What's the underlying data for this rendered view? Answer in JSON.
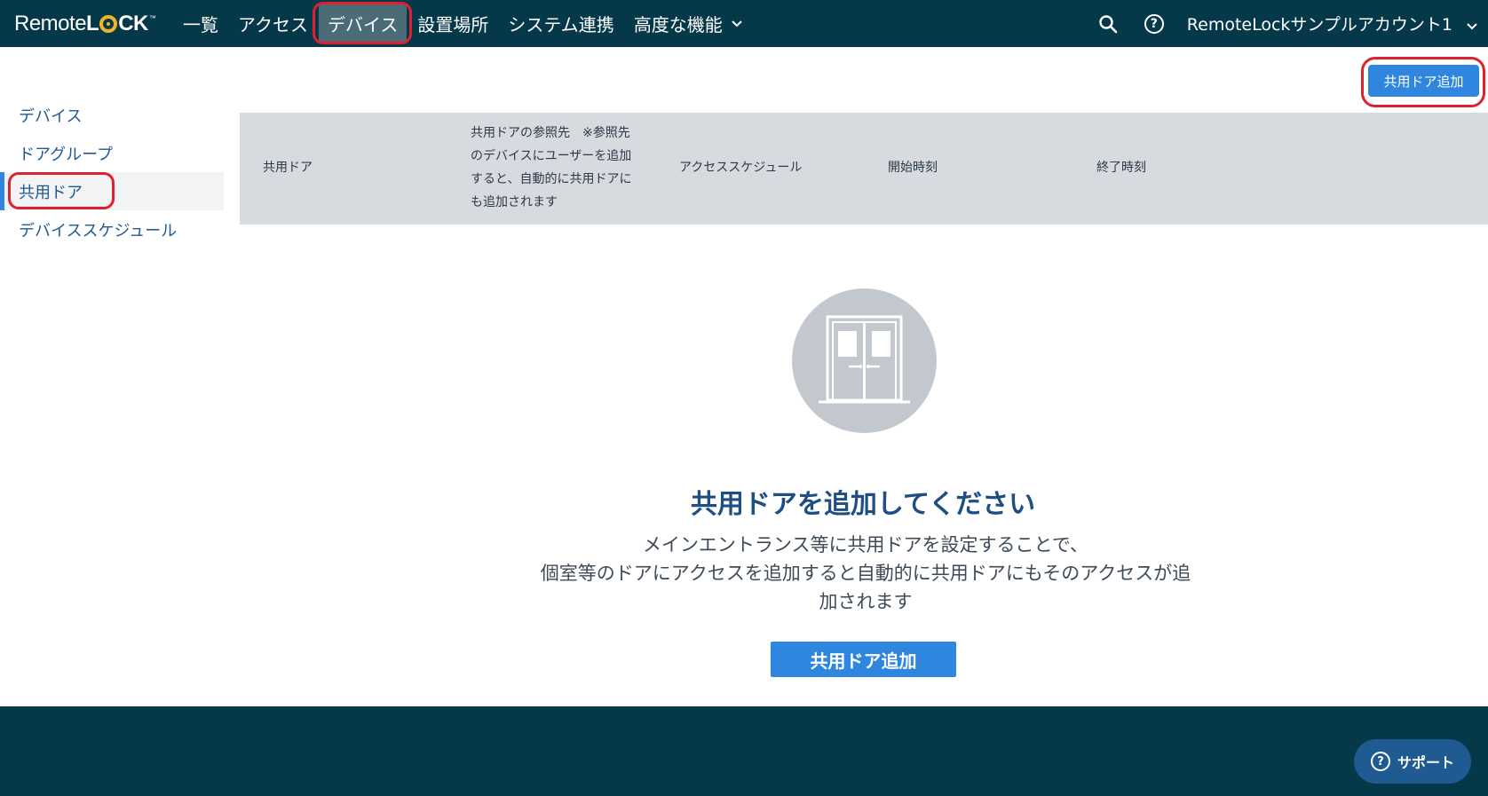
{
  "header": {
    "logo": {
      "prefix": "Remote",
      "brand_l": "L",
      "brand_rest": "CK",
      "tm": "™"
    },
    "nav": [
      {
        "label": "一覧"
      },
      {
        "label": "アクセス"
      },
      {
        "label": "デバイス",
        "active": true
      },
      {
        "label": "設置場所"
      },
      {
        "label": "システム連携"
      },
      {
        "label": "高度な機能",
        "has_dropdown": true
      }
    ],
    "search_icon": "search-icon",
    "help_icon": "help-icon",
    "help_glyph": "?",
    "account_name": "RemoteLockサンプルアカウント1"
  },
  "toolbar": {
    "add_shared_door_label": "共用ドア追加"
  },
  "sidebar": {
    "items": [
      {
        "label": "デバイス"
      },
      {
        "label": "ドアグループ"
      },
      {
        "label": "共用ドア",
        "active": true
      },
      {
        "label": "デバイススケジュール"
      }
    ]
  },
  "table": {
    "columns": [
      "共用ドア",
      "共用ドアの参照先　※参照先のデバイスにユーザーを追加すると、自動的に共用ドアにも追加されます",
      "アクセススケジュール",
      "開始時刻",
      "終了時刻"
    ]
  },
  "empty_state": {
    "icon": "double-door-icon",
    "title": "共用ドアを追加してください",
    "description_lines": [
      "メインエントランス等に共用ドアを設定することで、",
      "個室等のドアにアクセスを追加すると自動的に共用ドアにもそのアクセスが追",
      "加されます"
    ],
    "button_label": "共用ドア追加"
  },
  "support": {
    "label": "サポート",
    "glyph": "?"
  },
  "colors": {
    "header_bg": "#053849",
    "primary": "#2e86de",
    "link": "#1f5a93",
    "highlight": "#e0202e"
  }
}
